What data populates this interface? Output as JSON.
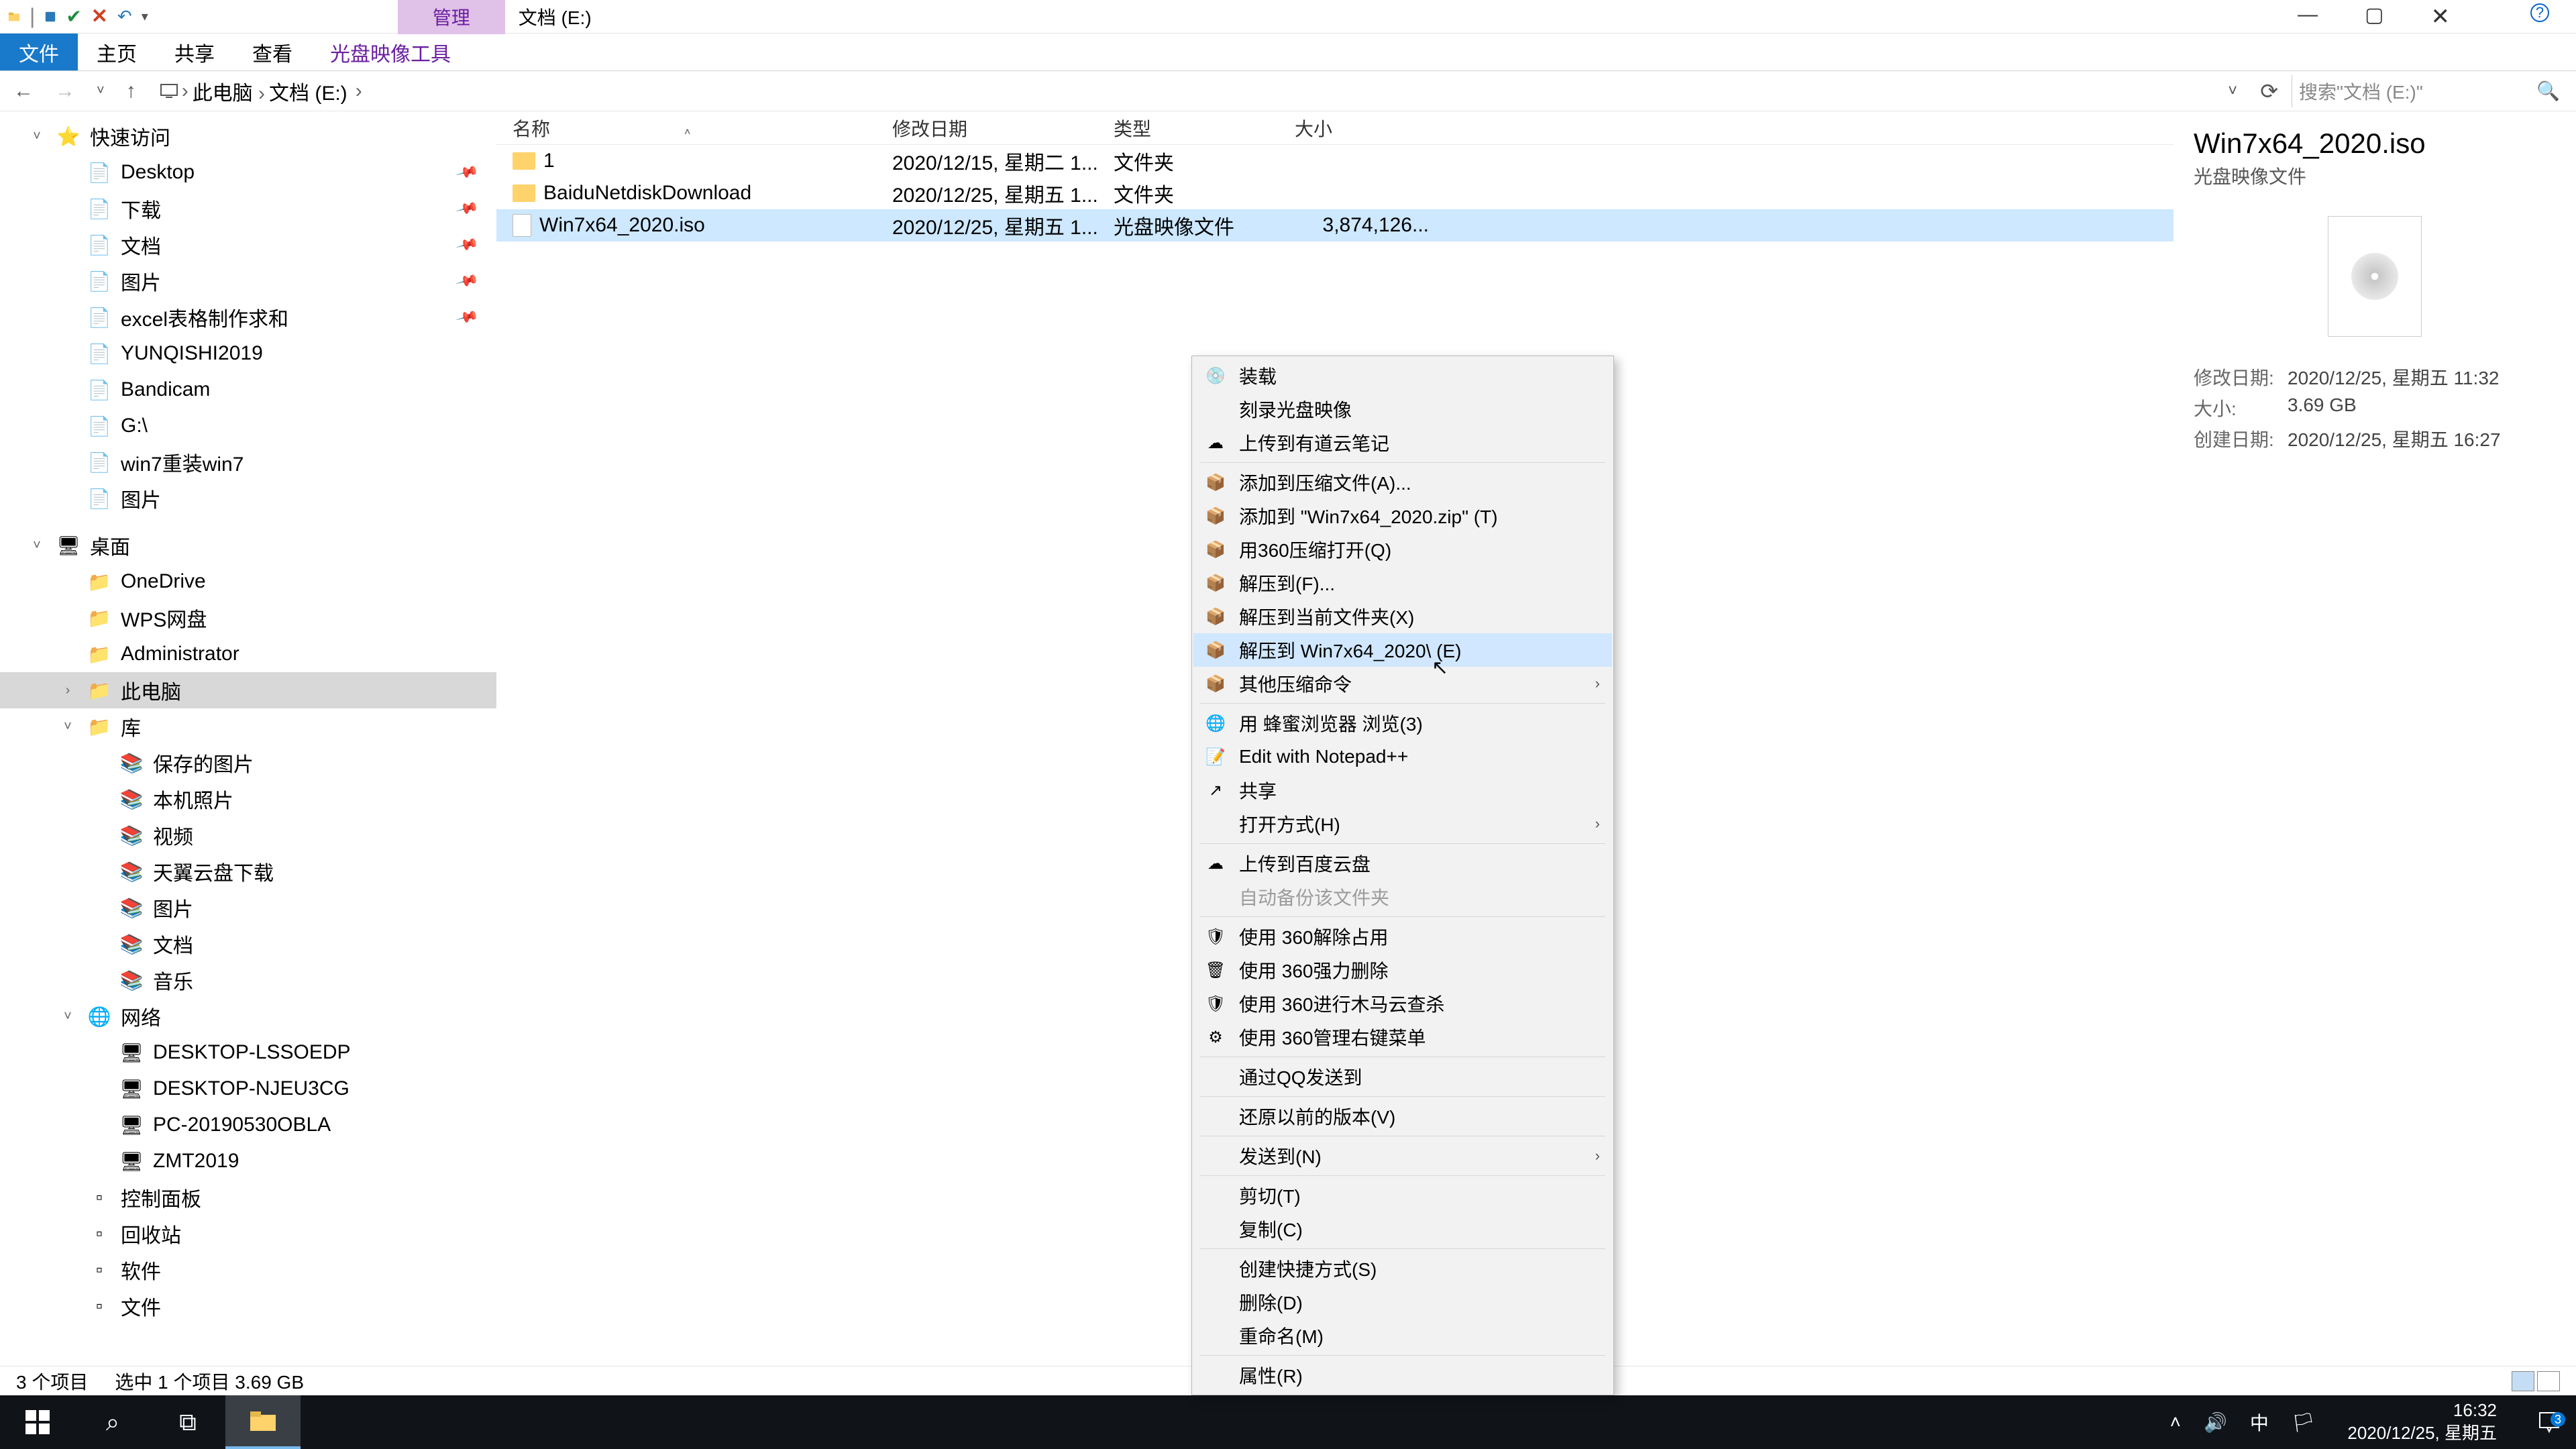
{
  "title": {
    "ctx_tab": "管理",
    "location": "文档 (E:)"
  },
  "ribbon": {
    "file": "文件",
    "home": "主页",
    "share": "共享",
    "view": "查看",
    "disc_tools": "光盘映像工具"
  },
  "address": {
    "crumbs": [
      "此电脑",
      "文档 (E:)"
    ],
    "search_placeholder": "搜索\"文档 (E:)\""
  },
  "nav": {
    "quick": "快速访问",
    "quick_items": [
      "Desktop",
      "下载",
      "文档",
      "图片",
      "excel表格制作求和",
      "YUNQISHI2019",
      "Bandicam",
      "G:\\",
      "win7重装win7",
      "图片"
    ],
    "pinned_count": 5,
    "desktop": "桌面",
    "desktop_items": [
      "OneDrive",
      "WPS网盘",
      "Administrator",
      "此电脑",
      "库"
    ],
    "lib_items": [
      "保存的图片",
      "本机照片",
      "视频",
      "天翼云盘下载",
      "图片",
      "文档",
      "音乐"
    ],
    "network": "网络",
    "network_items": [
      "DESKTOP-LSSOEDP",
      "DESKTOP-NJEU3CG",
      "PC-20190530OBLA",
      "ZMT2019"
    ],
    "extras": [
      "控制面板",
      "回收站",
      "软件",
      "文件"
    ],
    "selected": "此电脑"
  },
  "columns": {
    "name": "名称",
    "date": "修改日期",
    "type": "类型",
    "size": "大小"
  },
  "rows": [
    {
      "name": "1",
      "date": "2020/12/15, 星期二 1...",
      "type": "文件夹",
      "size": "",
      "icon": "folder"
    },
    {
      "name": "BaiduNetdiskDownload",
      "date": "2020/12/25, 星期五 1...",
      "type": "文件夹",
      "size": "",
      "icon": "folder"
    },
    {
      "name": "Win7x64_2020.iso",
      "date": "2020/12/25, 星期五 1...",
      "type": "光盘映像文件",
      "size": "3,874,126...",
      "icon": "iso",
      "selected": true
    }
  ],
  "ctx": {
    "g1": [
      "装载",
      "刻录光盘映像",
      "上传到有道云笔记"
    ],
    "g2": [
      "添加到压缩文件(A)...",
      "添加到 \"Win7x64_2020.zip\" (T)",
      "用360压缩打开(Q)",
      "解压到(F)...",
      "解压到当前文件夹(X)",
      "解压到 Win7x64_2020\\ (E)",
      "其他压缩命令"
    ],
    "g3": [
      "用 蜂蜜浏览器 浏览(3)",
      "Edit with Notepad++",
      "共享",
      "打开方式(H)"
    ],
    "g4": [
      "上传到百度云盘",
      "自动备份该文件夹"
    ],
    "g5": [
      "使用 360解除占用",
      "使用 360强力删除",
      "使用 360进行木马云查杀",
      "使用 360管理右键菜单"
    ],
    "g6": [
      "通过QQ发送到"
    ],
    "g7": [
      "还原以前的版本(V)"
    ],
    "g8": [
      "发送到(N)"
    ],
    "g9": [
      "剪切(T)",
      "复制(C)"
    ],
    "g10": [
      "创建快捷方式(S)",
      "删除(D)",
      "重命名(M)"
    ],
    "g11": [
      "属性(R)"
    ],
    "hover": "解压到 Win7x64_2020\\ (E)",
    "disabled": "自动备份该文件夹",
    "submenus": [
      "其他压缩命令",
      "打开方式(H)",
      "发送到(N)"
    ]
  },
  "details": {
    "title": "Win7x64_2020.iso",
    "subtitle": "光盘映像文件",
    "mod_label": "修改日期:",
    "mod": "2020/12/25, 星期五 11:32",
    "size_label": "大小:",
    "size": "3.69 GB",
    "created_label": "创建日期:",
    "created": "2020/12/25, 星期五 16:27"
  },
  "status": {
    "count": "3 个项目",
    "selection": "选中 1 个项目  3.69 GB"
  },
  "taskbar": {
    "time": "16:32",
    "date": "2020/12/25, 星期五",
    "ime": "中",
    "notif_count": "3"
  }
}
